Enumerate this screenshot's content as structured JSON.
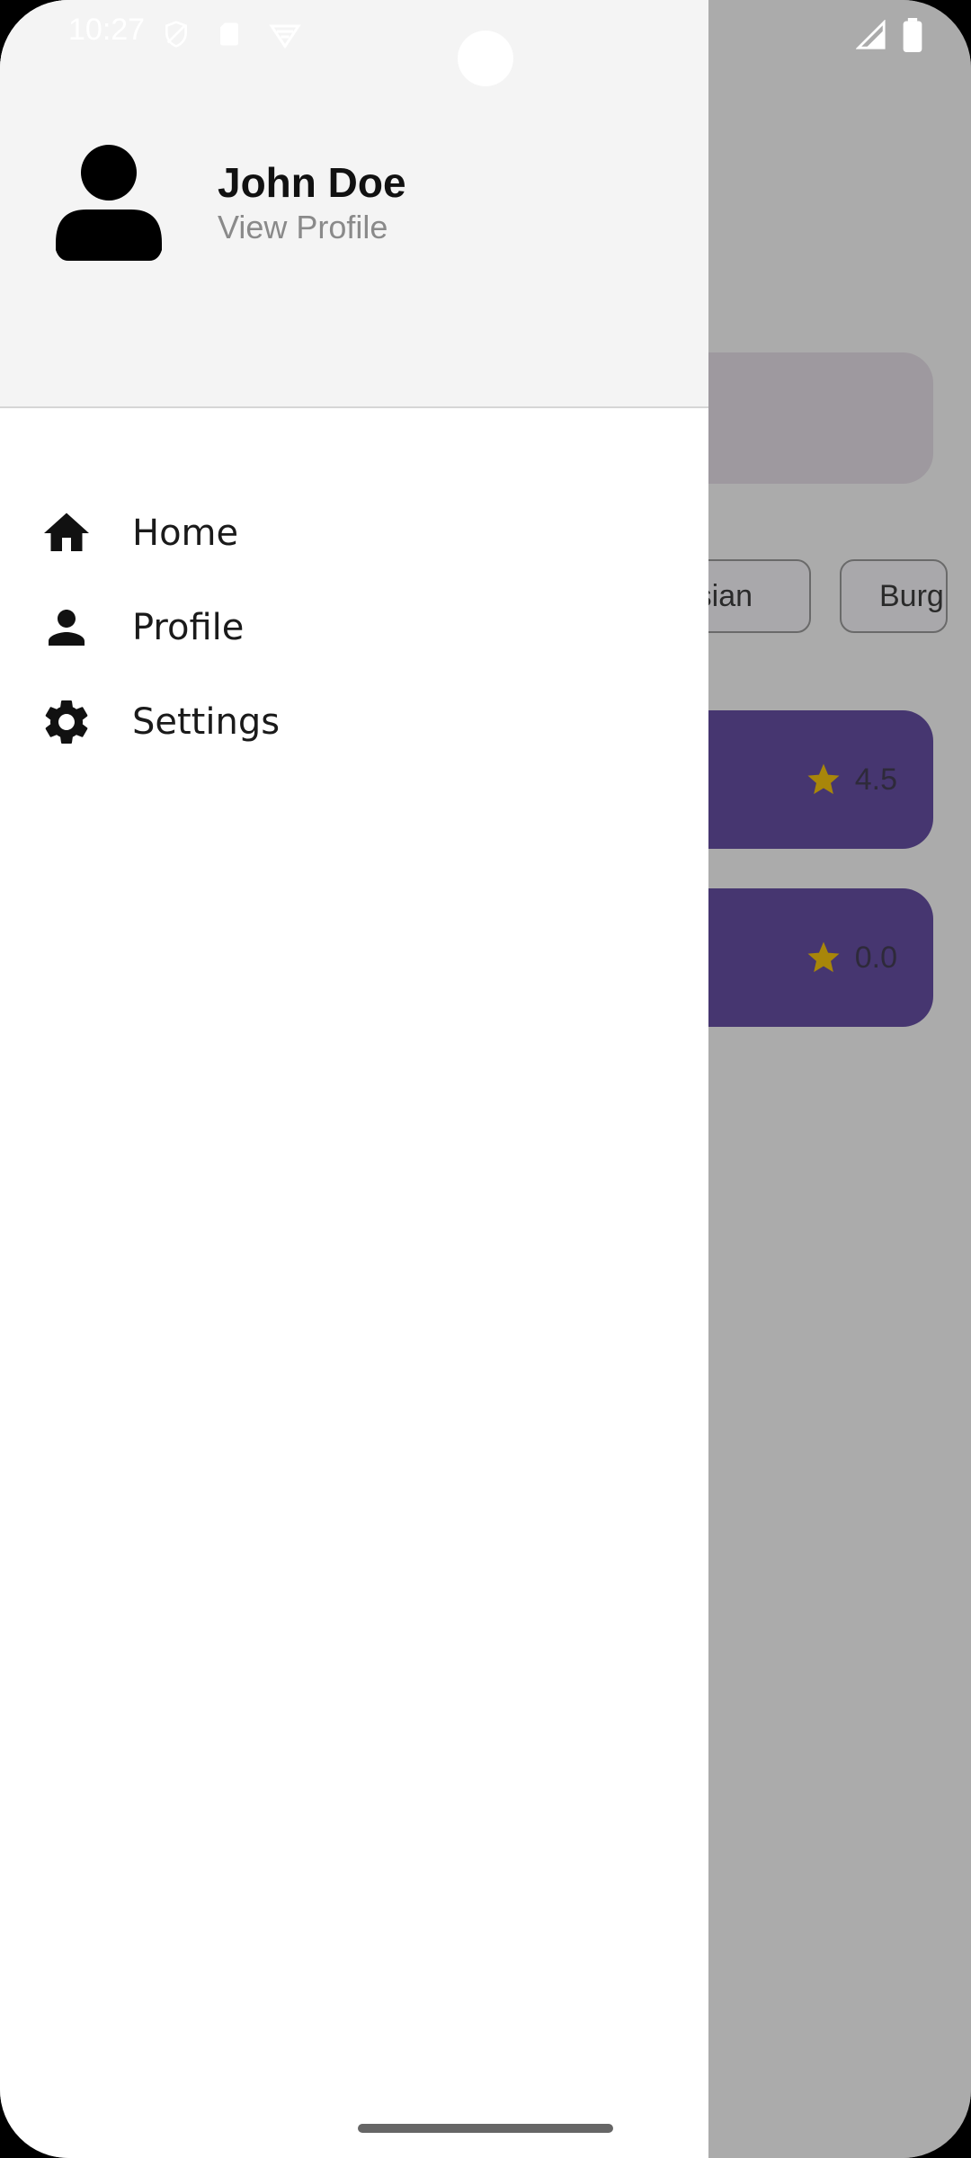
{
  "status_bar": {
    "time": "10:27",
    "left_icons": [
      "shield-icon",
      "sd-card-icon",
      "vpn-icon"
    ],
    "right_icons": [
      "signal-icon",
      "battery-icon"
    ]
  },
  "drawer": {
    "user": {
      "name": "John Doe",
      "subtitle": "View Profile",
      "avatar_icon": "person-icon"
    },
    "items": [
      {
        "icon": "home-icon",
        "label": "Home"
      },
      {
        "icon": "person-icon",
        "label": "Profile"
      },
      {
        "icon": "gear-icon",
        "label": "Settings"
      }
    ]
  },
  "background": {
    "chips": [
      "Asian",
      "Burg"
    ],
    "cards": [
      {
        "rating": "4.5"
      },
      {
        "rating": "0.0"
      }
    ]
  },
  "colors": {
    "drawer_header": "#f4f4f4",
    "scrim": "#ababab",
    "card_purple": "#463670",
    "star": "#a8860a"
  }
}
